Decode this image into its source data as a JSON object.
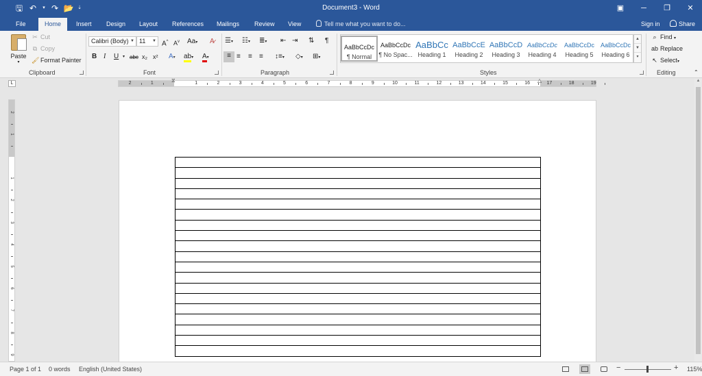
{
  "window": {
    "title": "Document3 - Word",
    "controls": {
      "ribbon_options": "▣",
      "minimize": "─",
      "restore": "❐",
      "close": "✕"
    }
  },
  "quick_access": {
    "save": "🖫",
    "undo": "↶",
    "undo_dd": "▾",
    "redo": "↷",
    "open": "📂",
    "customize": "⇣"
  },
  "tabs": [
    {
      "label": "File"
    },
    {
      "label": "Home"
    },
    {
      "label": "Insert"
    },
    {
      "label": "Design"
    },
    {
      "label": "Layout"
    },
    {
      "label": "References"
    },
    {
      "label": "Mailings"
    },
    {
      "label": "Review"
    },
    {
      "label": "View"
    }
  ],
  "active_tab": "Home",
  "tell_me": "Tell me what you want to do...",
  "account": {
    "sign_in": "Sign in",
    "share": "Share"
  },
  "clipboard": {
    "group_label": "Clipboard",
    "paste": "Paste",
    "cut": "Cut",
    "copy": "Copy",
    "format_painter": "Format Painter"
  },
  "font": {
    "group_label": "Font",
    "font_name": "Calibri (Body)",
    "font_size": "11",
    "grow": "A",
    "shrink": "A",
    "change_case": "Aa",
    "bold": "B",
    "italic": "I",
    "underline": "U",
    "strikethrough": "abc",
    "subscript": "x₂",
    "superscript": "x²"
  },
  "paragraph": {
    "group_label": "Paragraph",
    "pilcrow": "¶"
  },
  "styles": {
    "group_label": "Styles",
    "items": [
      {
        "sample": "AaBbCcDc",
        "name": "¶ Normal"
      },
      {
        "sample": "AaBbCcDc",
        "name": "¶ No Spac..."
      },
      {
        "sample": "AaBbCc",
        "name": "Heading 1"
      },
      {
        "sample": "AaBbCcE",
        "name": "Heading 2"
      },
      {
        "sample": "AaBbCcD",
        "name": "Heading 3"
      },
      {
        "sample": "AaBbCcDc",
        "name": "Heading 4"
      },
      {
        "sample": "AaBbCcDc",
        "name": "Heading 5"
      },
      {
        "sample": "AaBbCcDc",
        "name": "Heading 6"
      }
    ]
  },
  "editing": {
    "group_label": "Editing",
    "find": "Find",
    "replace": "Replace",
    "select": "Select"
  },
  "ruler": {
    "numbers": [
      "2",
      "1",
      "1",
      "2",
      "3",
      "4",
      "5",
      "6",
      "7",
      "8",
      "9",
      "10",
      "11",
      "12",
      "13",
      "14",
      "15",
      "16",
      "17",
      "18",
      "19"
    ]
  },
  "vruler": {
    "numbers": [
      "2",
      "1",
      "1",
      "2",
      "3",
      "4",
      "5",
      "6",
      "7",
      "8",
      "9"
    ]
  },
  "document": {
    "table_rows": 19
  },
  "status": {
    "page": "Page 1 of 1",
    "words": "0 words",
    "language": "English (United States)",
    "zoom_minus": "−",
    "zoom_plus": "+",
    "zoom_level": "115%"
  },
  "colors": {
    "accent": "#2b579a",
    "ribbon": "#f3f3f3",
    "canvas": "#e6e6e6"
  }
}
